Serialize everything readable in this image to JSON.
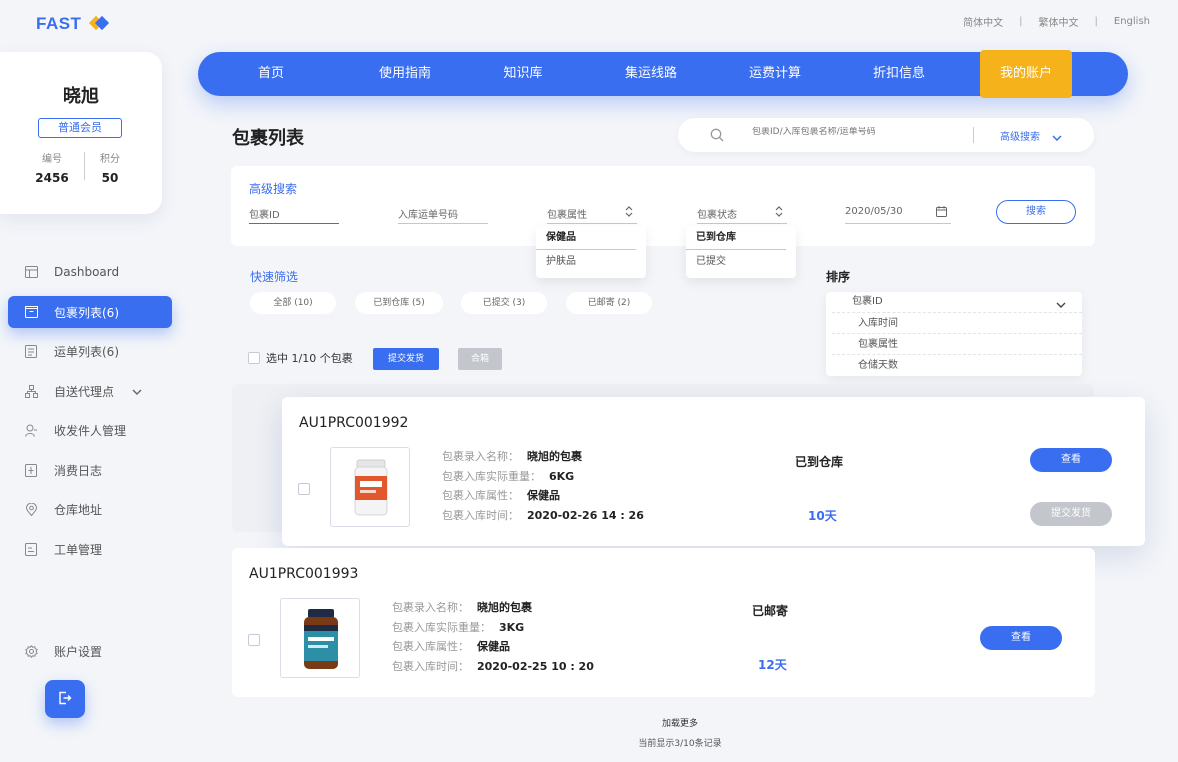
{
  "brand": {
    "name": "FAST"
  },
  "languages": [
    "简体中文",
    "繁体中文",
    "English"
  ],
  "profile": {
    "name": "晓旭",
    "level": "普通会员",
    "id_label": "编号",
    "id_value": "2456",
    "points_label": "积分",
    "points_value": "50"
  },
  "sidebar": {
    "items": [
      {
        "label": "Dashboard",
        "icon": "dashboard-icon"
      },
      {
        "label": "包裹列表(6)",
        "icon": "package-icon",
        "active": true
      },
      {
        "label": "运单列表(6)",
        "icon": "waybill-icon"
      },
      {
        "label": "自送代理点",
        "icon": "agent-icon"
      },
      {
        "label": "收发件人管理",
        "icon": "user-icon"
      },
      {
        "label": "消费日志",
        "icon": "log-icon"
      },
      {
        "label": "仓库地址",
        "icon": "location-icon"
      },
      {
        "label": "工单管理",
        "icon": "ticket-icon"
      }
    ],
    "settings_label": "账户设置"
  },
  "topnav": {
    "items": [
      "首页",
      "使用指南",
      "知识库",
      "集运线路",
      "运费计算",
      "折扣信息",
      "我的账户"
    ],
    "active_index": 6
  },
  "page_title": "包裹列表",
  "search": {
    "placeholder": "包裹ID/入库包裹名称/运单号码",
    "advanced_label": "高级搜索"
  },
  "advanced": {
    "title": "高级搜索",
    "package_id_placeholder": "包裹ID",
    "tracking_placeholder": "入库运单号码",
    "attr_label": "包裹属性",
    "attr_options": [
      "保健品",
      "护肤品"
    ],
    "status_label": "包裹状态",
    "status_options": [
      "已到仓库",
      "已提交"
    ],
    "date_value": "2020/05/30",
    "search_button": "搜索"
  },
  "quick_filter": {
    "title": "快速筛选",
    "chips": [
      "全部 (10)",
      "已到仓库 (5)",
      "已提交 (3)",
      "已邮寄 (2)"
    ]
  },
  "sort": {
    "title": "排序",
    "selected": "包裹ID",
    "options": [
      "入库时间",
      "包裹属性",
      "仓储天数"
    ]
  },
  "toolbar": {
    "select_text": "选中 1/10 个包裹",
    "submit_label": "提交发货",
    "combine_label": "合箱"
  },
  "packages": [
    {
      "id": "AU1PRC001992",
      "name_label": "包裹录入名称：",
      "name": "晓旭的包裹",
      "weight_label": "包裹入库实际重量：",
      "weight": "6KG",
      "attr_label": "包裹入库属性：",
      "attr": "保健品",
      "time_label": "包裹入库时间：",
      "time": "2020-02-26 14 : 26",
      "status": "已到仓库",
      "days": "10天",
      "view_label": "查看",
      "ship_label": "提交发货"
    },
    {
      "id": "AU1PRC001993",
      "name_label": "包裹录入名称：",
      "name": "晓旭的包裹",
      "weight_label": "包裹入库实际重量：",
      "weight": "3KG",
      "attr_label": "包裹入库属性：",
      "attr": "保健品",
      "time_label": "包裹入库时间：",
      "time": "2020-02-25 10 : 20",
      "status": "已邮寄",
      "days": "12天",
      "view_label": "查看"
    }
  ],
  "footer": {
    "load_more": "加载更多",
    "count_text": "当前显示3/10条记录"
  },
  "colors": {
    "primary": "#3a6ef0",
    "accent": "#f6b21b",
    "disabled": "#c3c6cc"
  }
}
